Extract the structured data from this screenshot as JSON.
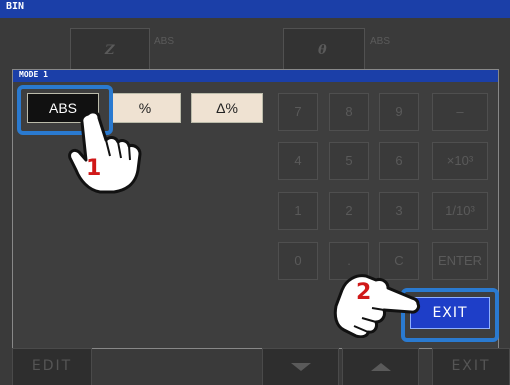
{
  "window": {
    "title": "BIN"
  },
  "top_params": [
    {
      "symbol": "Z",
      "mode": "ABS"
    },
    {
      "symbol": "θ",
      "mode": "ABS"
    }
  ],
  "dialog": {
    "title": "MODE 1",
    "mode_options": [
      {
        "label": "ABS",
        "selected": true
      },
      {
        "label": "%",
        "selected": false
      },
      {
        "label": "Δ%",
        "selected": false
      }
    ],
    "keypad": [
      "7",
      "8",
      "9",
      "–",
      "4",
      "5",
      "6",
      "×10³",
      "1",
      "2",
      "3",
      "1/10³",
      "0",
      ".",
      "C",
      "ENTER"
    ],
    "exit_label": "EXIT"
  },
  "bottom_bar": {
    "edit_label": "EDIT",
    "exit_label": "EXIT"
  },
  "callouts": [
    {
      "number": "1"
    },
    {
      "number": "2"
    }
  ],
  "colors": {
    "titlebar": "#1b3fa8",
    "highlight": "#2a7ad0",
    "exit_button": "#1e3ec8",
    "mode_button": "#efe2d2"
  }
}
